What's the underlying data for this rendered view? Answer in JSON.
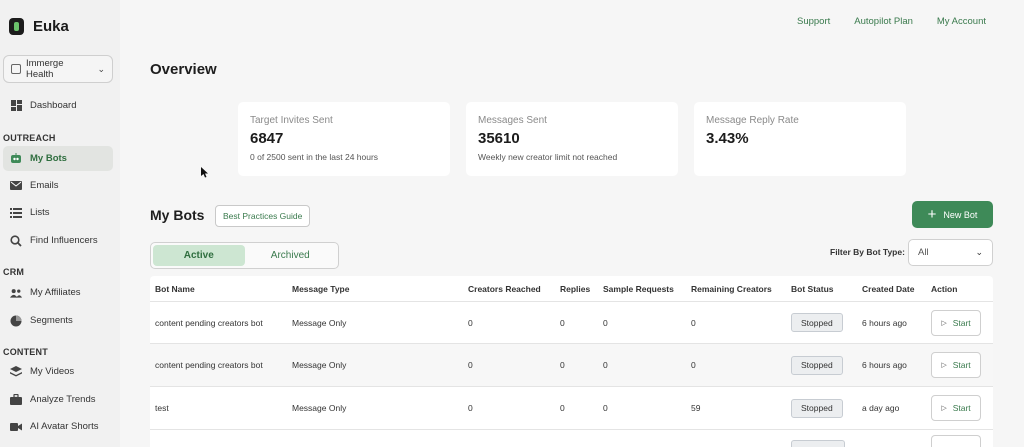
{
  "app": {
    "name": "Euka"
  },
  "organization": {
    "name": "Immerge Health"
  },
  "sidebar": {
    "items_top": [
      {
        "label": "Dashboard"
      }
    ],
    "sections": [
      {
        "title": "OUTREACH",
        "items": [
          {
            "label": "My Bots",
            "active": true
          },
          {
            "label": "Emails"
          },
          {
            "label": "Lists"
          },
          {
            "label": "Find Influencers"
          }
        ]
      },
      {
        "title": "CRM",
        "items": [
          {
            "label": "My Affiliates"
          },
          {
            "label": "Segments"
          }
        ]
      },
      {
        "title": "CONTENT",
        "items": [
          {
            "label": "My Videos"
          },
          {
            "label": "Analyze Trends"
          },
          {
            "label": "AI Avatar Shorts"
          }
        ]
      }
    ]
  },
  "top_links": [
    "Support",
    "Autopilot Plan",
    "My Account"
  ],
  "overview": {
    "title": "Overview",
    "cards": [
      {
        "label": "Target Invites Sent",
        "value": "6847",
        "sub": "0 of 2500 sent in the last 24 hours"
      },
      {
        "label": "Messages Sent",
        "value": "35610",
        "sub": "Weekly new creator limit not reached"
      },
      {
        "label": "Message Reply Rate",
        "value": "3.43%",
        "sub": ""
      }
    ]
  },
  "bots": {
    "title": "My Bots",
    "guide_label": "Best Practices Guide",
    "new_bot_label": "New Bot",
    "tabs": [
      {
        "label": "Active",
        "active": true
      },
      {
        "label": "Archived"
      }
    ],
    "filter": {
      "label": "Filter By Bot Type:",
      "value": "All"
    },
    "columns": [
      "Bot Name",
      "Message Type",
      "Creators Reached",
      "Replies",
      "Sample Requests",
      "Remaining Creators",
      "Bot Status",
      "Created Date",
      "Action"
    ],
    "rows": [
      {
        "name": "content pending creators bot",
        "type": "Message Only",
        "reached": "0",
        "replies": "0",
        "samples": "0",
        "remaining": "0",
        "status": "Stopped",
        "created": "6 hours ago",
        "action": "Start"
      },
      {
        "name": "content pending creators bot",
        "type": "Message Only",
        "reached": "0",
        "replies": "0",
        "samples": "0",
        "remaining": "0",
        "status": "Stopped",
        "created": "6 hours ago",
        "action": "Start"
      },
      {
        "name": "test",
        "type": "Message Only",
        "reached": "0",
        "replies": "0",
        "samples": "0",
        "remaining": "59",
        "status": "Stopped",
        "created": "a day ago",
        "action": "Start"
      }
    ]
  },
  "colors": {
    "accent": "#3e8a58",
    "link": "#3a7a4d",
    "active_tab": "#cde6d2"
  }
}
